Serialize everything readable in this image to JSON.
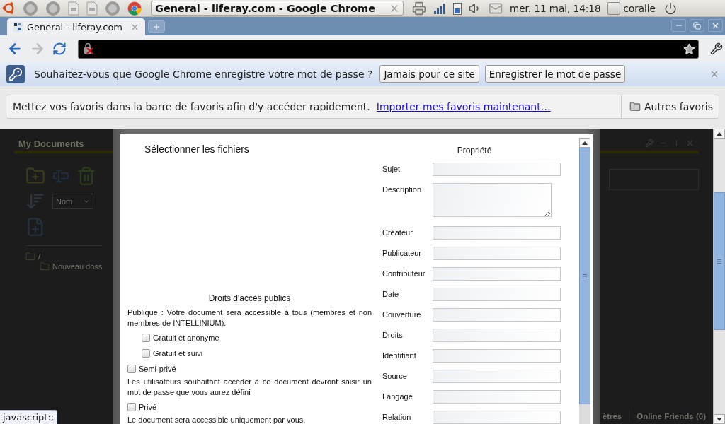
{
  "top_panel": {
    "window_title": "General - liferay.com - Google Chrome",
    "clock": "mer. 11 mai, 14:18",
    "user": "coralie"
  },
  "browser": {
    "tabs": [
      {
        "label": "General - liferay.com",
        "selected": true
      }
    ],
    "infobar": {
      "message": "Souhaitez-vous que Google Chrome enregistre votre mot de passe ?",
      "buttons": [
        "Jamais pour ce site",
        "Enregistrer le mot de passe"
      ]
    },
    "bookmarks_bar": {
      "message": "Mettez vos favoris dans la barre de favoris afin d'y accéder rapidement.",
      "link": "Importer mes favoris maintenant…",
      "other": "Autres favoris"
    }
  },
  "page": {
    "portlet_title": "My Documents",
    "sort_select": "Nom",
    "tree": [
      {
        "label": "/",
        "children": [
          {
            "label": "Nouveau doss"
          }
        ]
      }
    ],
    "bottom_tabs": [
      "ètres",
      "Online Friends (0)"
    ]
  },
  "dialog": {
    "upload_title": "Sélectionner les fichiers",
    "access": {
      "title": "Droits d'accès publics",
      "items": [
        {
          "kind": "note",
          "text": "Publique : Votre document sera accessible à tous (membres et non membres de INTELLINIUM).",
          "children": [
            {
              "kind": "option",
              "label": "Gratuit et anonyme",
              "checked": false
            },
            {
              "kind": "option",
              "label": "Gratuit et suivi",
              "checked": false
            }
          ]
        },
        {
          "kind": "option",
          "label": "Semi-privé",
          "checked": false
        },
        {
          "kind": "note",
          "text": "Les utilisateurs souhaitant accéder à ce document devront saisir un mot de passe que vous aurez défini"
        },
        {
          "kind": "option",
          "label": "Privé",
          "checked": false
        },
        {
          "kind": "note",
          "text": "Le document sera accessible uniquement par vous."
        }
      ]
    },
    "properties": {
      "title": "Propriété",
      "fields": [
        {
          "label": "Sujet",
          "kind": "text"
        },
        {
          "label": "Description",
          "kind": "textarea"
        },
        {
          "label": "Créateur",
          "kind": "text"
        },
        {
          "label": "Publicateur",
          "kind": "text"
        },
        {
          "label": "Contributeur",
          "kind": "text"
        },
        {
          "label": "Date",
          "kind": "text"
        },
        {
          "label": "Couverture",
          "kind": "text"
        },
        {
          "label": "Droits",
          "kind": "text"
        },
        {
          "label": "Identifiant",
          "kind": "text"
        },
        {
          "label": "Source",
          "kind": "text"
        },
        {
          "label": "Langage",
          "kind": "text"
        },
        {
          "label": "Relation",
          "kind": "text"
        }
      ]
    }
  },
  "status_bubble": "javascript:;"
}
